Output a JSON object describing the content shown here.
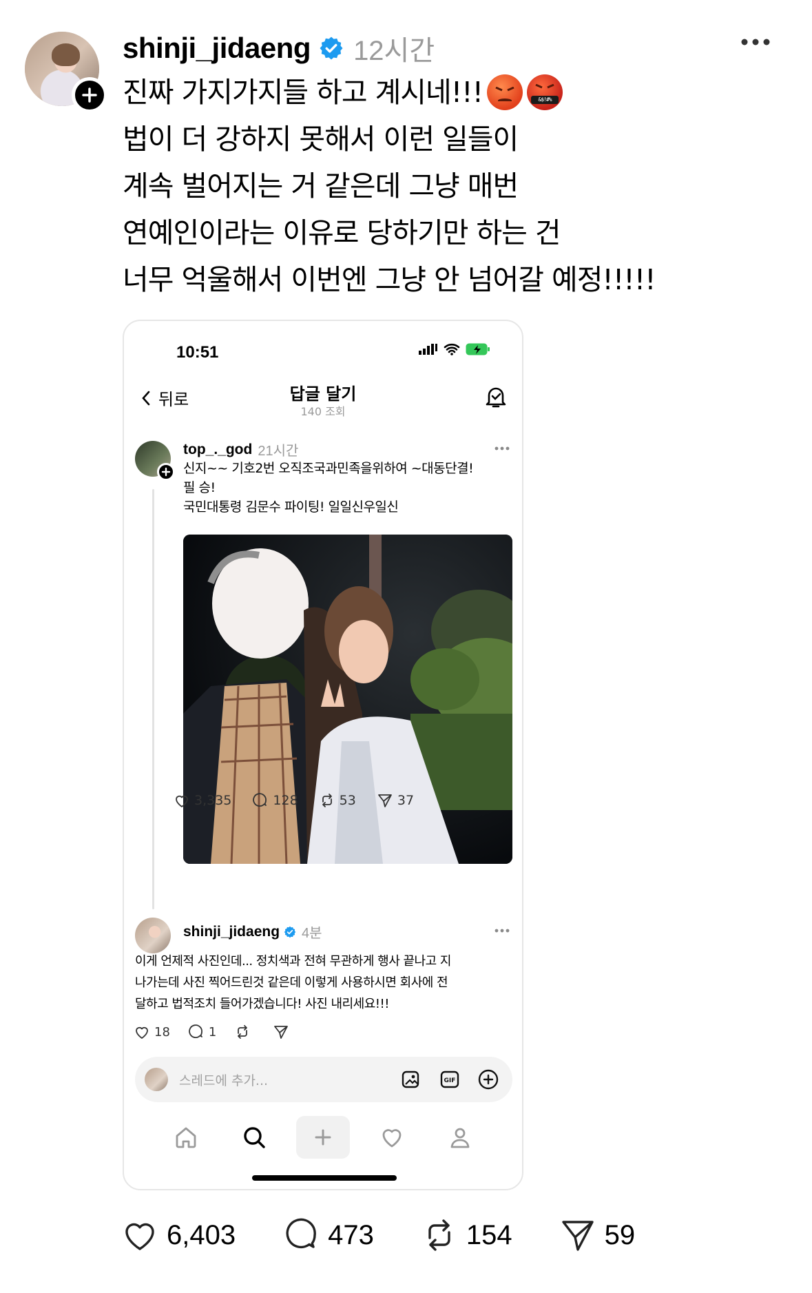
{
  "post": {
    "username": "shinji_jidaeng",
    "time": "12시간",
    "text_lines": [
      "진짜 가지가지들 하고 계시네!!!",
      "법이 더 강하지 못해서 이런 일들이",
      "계속 벌어지는 거 같은데 그냥 매번",
      "연예인이라는 이유로 당하기만 하는 건",
      "너무 억울해서 이번엔 그냥 안 넘어갈 예정!!!!!"
    ],
    "emoji": [
      "angry-face-icon",
      "face-with-symbols-on-mouth-icon"
    ],
    "emoji_symbols": "&$!#%",
    "stats": {
      "likes": "6,403",
      "replies": "473",
      "reposts": "154",
      "shares": "59"
    }
  },
  "embedded": {
    "status_time": "10:51",
    "nav": {
      "back_label": "뒤로",
      "title": "답글 달기",
      "subtitle": "140 조회"
    },
    "original": {
      "username": "top_._god",
      "time": "21시간",
      "text_lines": [
        "신지~~ 기호2번  오직조국과민족을위하여 ~대동단결!",
        "필 승!",
        "국민대통령 김문수 파이팅! 일일신우일신"
      ],
      "stats": {
        "likes": "3,335",
        "replies": "128",
        "reposts": "53",
        "shares": "37"
      }
    },
    "reply": {
      "username": "shinji_jidaeng",
      "time": "4분",
      "text_lines": [
        "이게 언제적 사진인데... 정치색과 전혀 무관하게 행사 끝나고 지",
        "나가는데 사진 찍어드린것 같은데 이렇게 사용하시면 회사에 전",
        "달하고 법적조치 들어가겠습니다! 사진 내리세요!!!"
      ],
      "stats": {
        "likes": "18",
        "replies": "1"
      }
    },
    "reply_input": {
      "placeholder": "스레드에 추가..."
    },
    "gif_label": "GIF"
  },
  "colors": {
    "verified": "#1d9bf0",
    "muted": "#9a9a9a"
  }
}
